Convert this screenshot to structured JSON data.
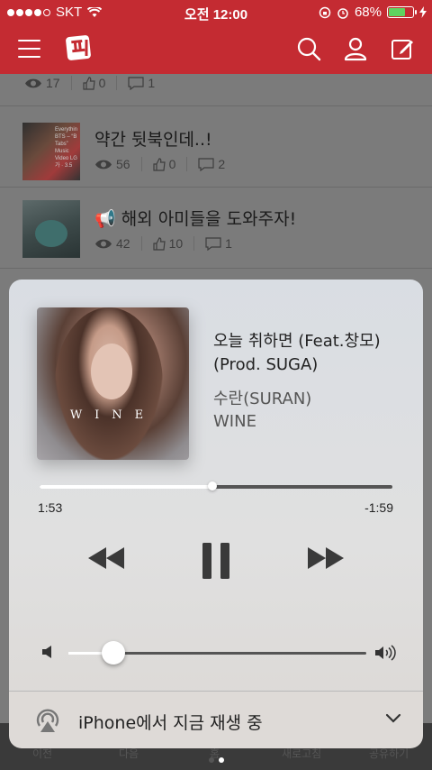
{
  "status": {
    "carrier": "SKT",
    "time": "오전 12:00",
    "battery": "68%"
  },
  "feed": {
    "top_row": {
      "views": "17",
      "likes": "0",
      "comments": "1"
    },
    "rows": [
      {
        "thumb_text": "Everythin BTS – “B Tabs” Music Video LG 가 · 3.5",
        "title": "약간 뒷북인데..!",
        "views": "56",
        "likes": "0",
        "comments": "2"
      },
      {
        "title": "📢 해외 아미들을 도와주자!",
        "views": "42",
        "likes": "10",
        "comments": "1"
      }
    ]
  },
  "tabbar": [
    "이전",
    "다음",
    "홈",
    "새로고침",
    "공유하기"
  ],
  "player": {
    "art_text": "WINE",
    "title": "오늘 취하면 (Feat.창모) (Prod. SUGA)",
    "artist": "수란(SURAN)",
    "album": "WINE",
    "elapsed": "1:53",
    "remaining": "-1:59",
    "progress_fraction": 0.49,
    "volume_fraction": 0.15,
    "airplay_label": "iPhone에서 지금 재생 중"
  },
  "colors": {
    "brand": "#c42b32",
    "battery_fill": "#5fd35f"
  }
}
